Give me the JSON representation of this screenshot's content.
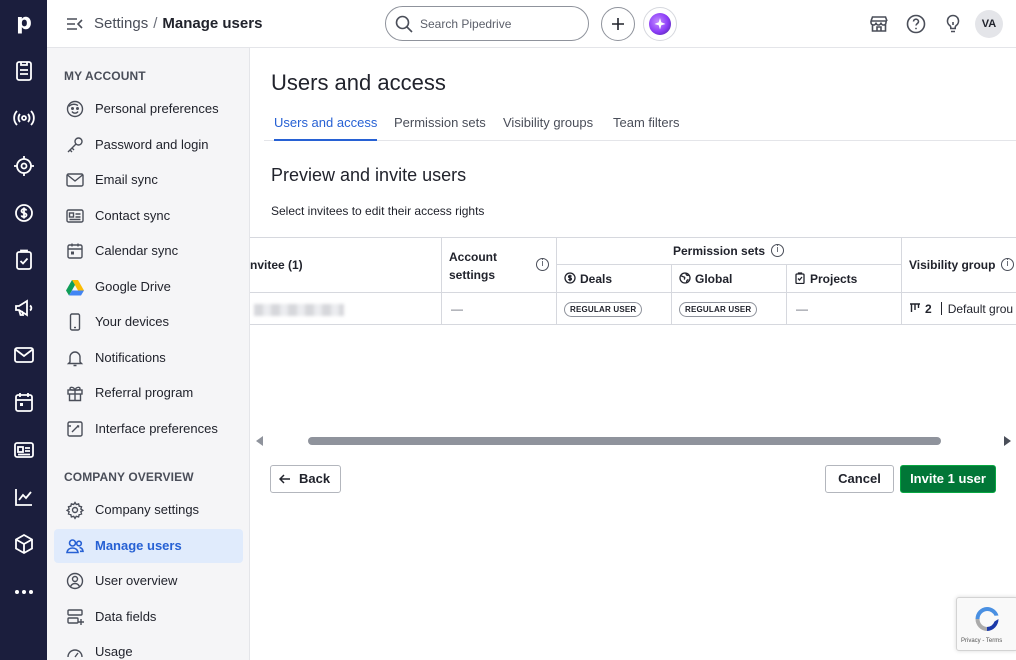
{
  "app": {
    "logo_letter": "p"
  },
  "rail": {
    "items": [
      "deals-icon",
      "leads-icon",
      "contacts-icon",
      "billing-icon",
      "tasks-icon",
      "campaigns-icon",
      "mail-icon",
      "calendar-icon",
      "contacts-card-icon",
      "insights-icon",
      "products-icon",
      "more-icon"
    ]
  },
  "topbar": {
    "breadcrumb_parent": "Settings",
    "breadcrumb_sep": "/",
    "breadcrumb_current": "Manage users",
    "search_placeholder": "Search Pipedrive",
    "avatar_initials": "VA"
  },
  "sidebar": {
    "my_account_title": "MY ACCOUNT",
    "my_account_items": [
      {
        "label": "Personal preferences",
        "icon": "smiley-icon"
      },
      {
        "label": "Password and login",
        "icon": "key-icon"
      },
      {
        "label": "Email sync",
        "icon": "envelope-icon"
      },
      {
        "label": "Contact sync",
        "icon": "contact-card-icon"
      },
      {
        "label": "Calendar sync",
        "icon": "calendar-icon"
      },
      {
        "label": "Google Drive",
        "icon": "google-drive-icon"
      },
      {
        "label": "Your devices",
        "icon": "phone-icon"
      },
      {
        "label": "Notifications",
        "icon": "bell-icon"
      },
      {
        "label": "Referral program",
        "icon": "gift-icon"
      },
      {
        "label": "Interface preferences",
        "icon": "interface-icon"
      }
    ],
    "company_title": "COMPANY OVERVIEW",
    "company_items": [
      {
        "label": "Company settings",
        "icon": "gear-icon"
      },
      {
        "label": "Manage users",
        "icon": "users-icon",
        "active": true
      },
      {
        "label": "User overview",
        "icon": "user-circle-icon"
      },
      {
        "label": "Data fields",
        "icon": "data-fields-icon"
      },
      {
        "label": "Usage",
        "icon": "gauge-icon"
      }
    ]
  },
  "main": {
    "page_title": "Users and access",
    "tabs": [
      "Users and access",
      "Permission sets",
      "Visibility groups",
      "Team filters"
    ],
    "active_tab": "Users and access",
    "section_title": "Preview and invite users",
    "section_desc": "Select invitees to edit their access rights"
  },
  "table": {
    "col_invitee": "nvitee (1)",
    "col_account_settings": "Account settings",
    "col_permission_sets": "Permission sets",
    "col_deals": "Deals",
    "col_global": "Global",
    "col_projects": "Projects",
    "col_visibility_group": "Visibility group",
    "rows": [
      {
        "account_settings": "—",
        "deals": "REGULAR USER",
        "global": "REGULAR USER",
        "projects": "—",
        "visibility_count": "2",
        "visibility_name": "Default grou"
      }
    ]
  },
  "actions": {
    "back": "Back",
    "cancel": "Cancel",
    "invite": "Invite 1 user"
  },
  "recaptcha": {
    "text": "Privacy - Terms"
  },
  "colors": {
    "rail_bg": "#1b1e3d",
    "accent_blue": "#2761d4",
    "active_bg": "#e0ebfc",
    "invite_green": "#017737"
  }
}
